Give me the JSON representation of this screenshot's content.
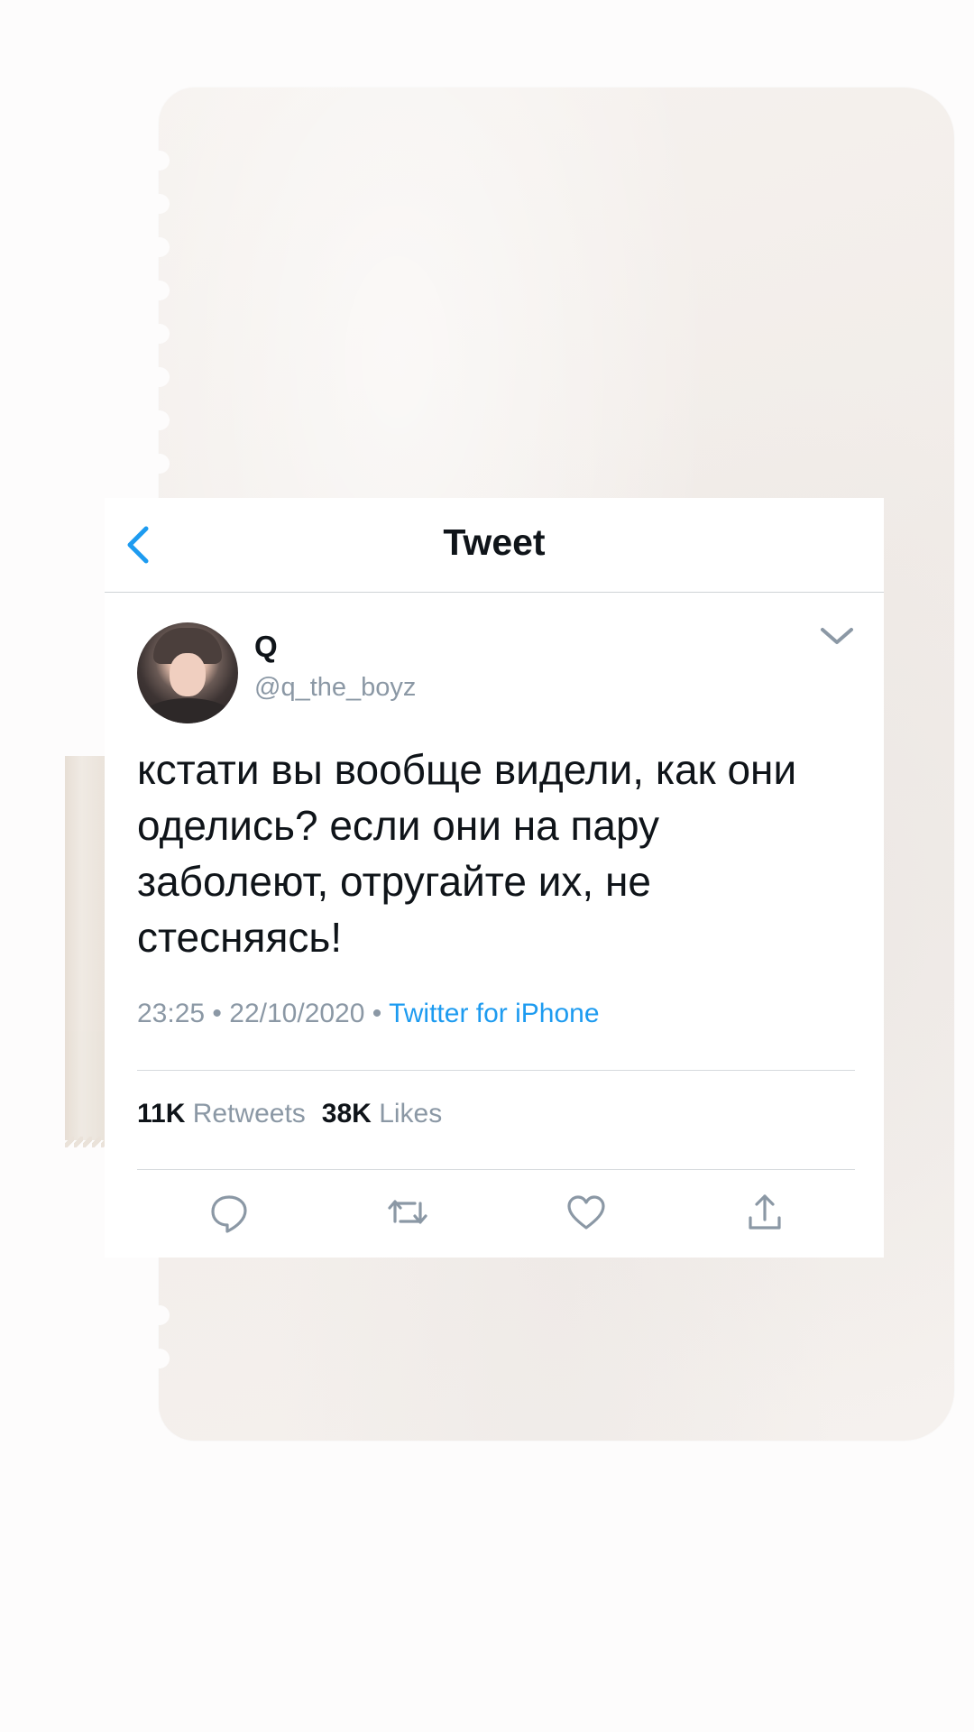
{
  "header": {
    "title": "Tweet",
    "back_icon": "chevron-left-icon"
  },
  "author": {
    "display_name": "Q",
    "handle": "@q_the_boyz"
  },
  "tweet": {
    "text": "кстати вы вообще видели, как они оделись? если они на пару заболеют, отругайте их, не стесняясь!",
    "time": "23:25",
    "separator": "•",
    "date": "22/10/2020",
    "source": "Twitter for iPhone"
  },
  "stats": {
    "retweets_count": "11K",
    "retweets_label": "Retweets",
    "likes_count": "38K",
    "likes_label": "Likes"
  },
  "actions": [
    "reply-icon",
    "retweet-icon",
    "like-icon",
    "share-icon"
  ],
  "colors": {
    "accent": "#1d9bf0",
    "text_primary": "#0f1419",
    "text_secondary": "#8b98a5",
    "paper": "#f4f0ed"
  }
}
